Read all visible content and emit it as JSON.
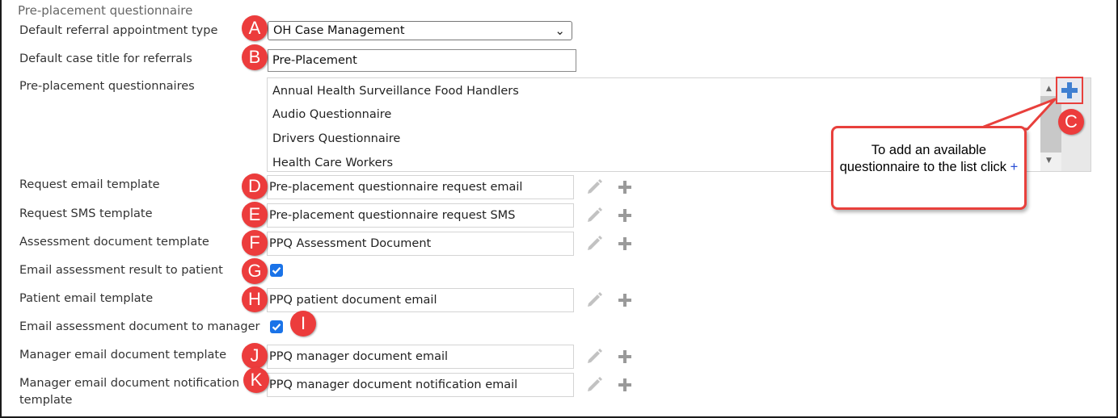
{
  "section_title": "Pre-placement questionnaire",
  "fields": {
    "referral_type": {
      "label": "Default referral appointment type",
      "value": "OH Case Management",
      "marker": "A"
    },
    "case_title": {
      "label": "Default case title for referrals",
      "value": "Pre-Placement",
      "marker": "B"
    },
    "questionnaires": {
      "label": "Pre-placement questionnaires",
      "items": [
        "Annual Health Surveillance Food Handlers",
        "Audio Questionnaire",
        "Drivers Questionnaire",
        "Health Care Workers"
      ],
      "marker": "C"
    },
    "request_email": {
      "label": "Request email template",
      "value": "Pre-placement questionnaire request email",
      "marker": "D"
    },
    "request_sms": {
      "label": "Request SMS template",
      "value": "Pre-placement questionnaire request SMS",
      "marker": "E"
    },
    "assessment_doc": {
      "label": "Assessment document template",
      "value": "PPQ Assessment Document",
      "marker": "F"
    },
    "email_result_patient": {
      "label": "Email assessment result to patient",
      "checked": true,
      "marker": "G"
    },
    "patient_email": {
      "label": "Patient email template",
      "value": "PPQ patient document email",
      "marker": "H"
    },
    "email_doc_manager": {
      "label": "Email assessment document to manager",
      "checked": true,
      "marker": "I"
    },
    "manager_email_doc": {
      "label": "Manager email document template",
      "value": "PPQ manager document email",
      "marker": "J"
    },
    "manager_notify": {
      "label": "Manager email document notification template",
      "value": "PPQ manager document notification email",
      "marker": "K"
    }
  },
  "callout": {
    "text": "To add an available questionnaire  to the list click",
    "plus": "+"
  },
  "colors": {
    "marker": "#ec3c3c",
    "checkbox": "#1a73e8",
    "add_icon": "#3f7fd1",
    "callout_border": "#e8403c"
  }
}
